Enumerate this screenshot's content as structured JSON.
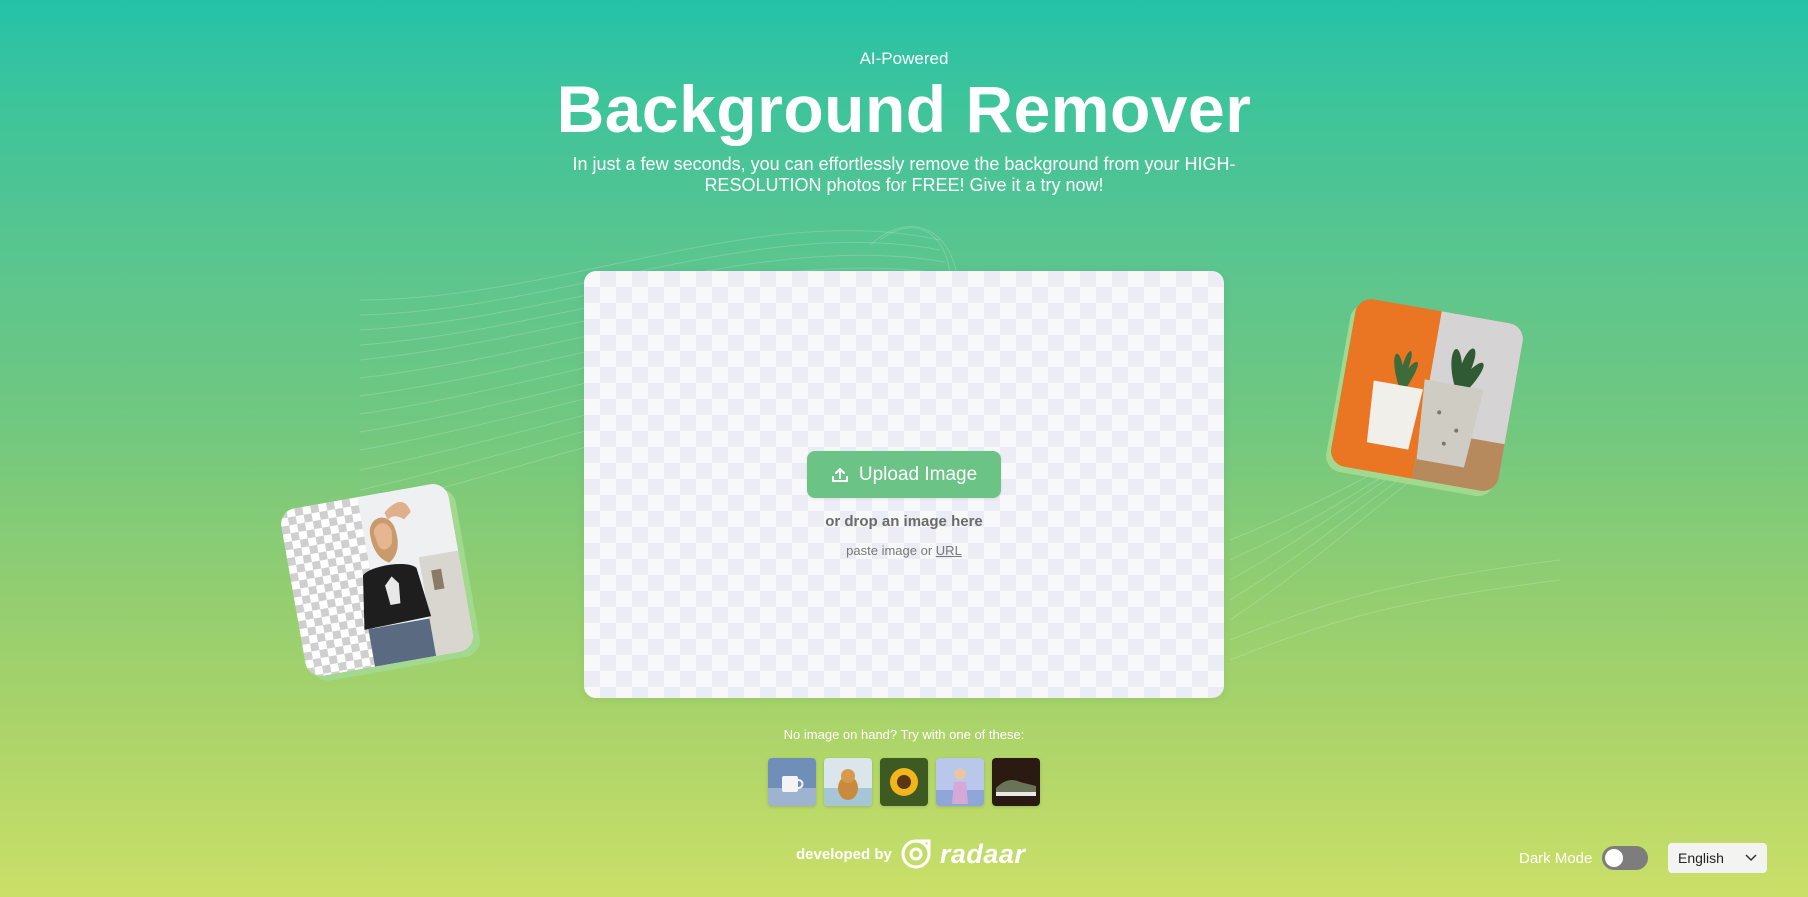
{
  "header": {
    "eyebrow": "AI-Powered",
    "title": "Background Remover",
    "subtitle": "In just a few seconds, you can effortlessly remove the background from your HIGH-RESOLUTION photos for FREE! Give it a try now!"
  },
  "uploader": {
    "button_label": "Upload Image",
    "button_icon": "upload-icon",
    "drop_text": "or drop an image here",
    "paste_prefix": "paste image or",
    "url_link": "URL"
  },
  "samples": {
    "label": "No image on hand? Try with one of these:",
    "items": [
      "mug",
      "dog",
      "sunflower",
      "woman",
      "sneaker"
    ]
  },
  "footer": {
    "credit": "developed by",
    "brand": "radaar",
    "dark_mode_label": "Dark Mode",
    "dark_mode_on": false,
    "language": "English"
  },
  "colors": {
    "accent": "#6cc386",
    "gradient_top": "#25c2a8",
    "gradient_bottom": "#cbdf68",
    "demo_orange": "#ea7623"
  }
}
